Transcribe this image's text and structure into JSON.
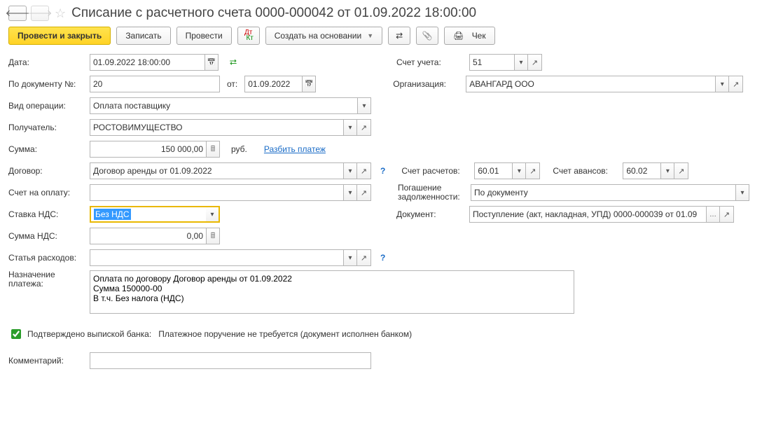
{
  "title": "Списание с расчетного счета 0000-000042 от 01.09.2022 18:00:00",
  "toolbar": {
    "post_close": "Провести и закрыть",
    "save": "Записать",
    "post": "Провести",
    "create_based": "Создать на основании",
    "cheque": "Чек"
  },
  "labels": {
    "date": "Дата:",
    "doc_no": "По документу №:",
    "from": "от:",
    "account": "Счет учета:",
    "organization": "Организация:",
    "op_type": "Вид операции:",
    "recipient": "Получатель:",
    "amount": "Сумма:",
    "rub": "руб.",
    "split": "Разбить платеж",
    "contract": "Договор:",
    "settle_acc": "Счет расчетов:",
    "advance_acc": "Счет авансов:",
    "invoice": "Счет на оплату:",
    "debt_repay1": "Погашение",
    "debt_repay2": "задолженности:",
    "vat_rate": "Ставка НДС:",
    "document": "Документ:",
    "vat_sum": "Сумма НДС:",
    "expense_item": "Статья расходов:",
    "purpose1": "Назначение",
    "purpose2": "платежа:",
    "bank_confirm": "Подтверждено выпиской банка:",
    "bank_confirm_text": "Платежное поручение не требуется (документ исполнен банком)",
    "comment": "Комментарий:"
  },
  "values": {
    "date": "01.09.2022 18:00:00",
    "doc_no": "20",
    "doc_date": "01.09.2022",
    "account": "51",
    "organization": "АВАНГАРД ООО",
    "op_type": "Оплата поставщику",
    "recipient": "РОСТОВИМУЩЕСТВО",
    "amount": "150 000,00",
    "contract": "Договор аренды от 01.09.2022",
    "settle_acc": "60.01",
    "advance_acc": "60.02",
    "debt_repay": "По документу",
    "vat_rate": "Без НДС",
    "document_ref": "Поступление (акт, накладная, УПД) 0000-000039 от 01.09",
    "vat_sum": "0,00",
    "purpose": "Оплата по договору Договор аренды от 01.09.2022\nСумма 150000-00\nВ т.ч. Без налога (НДС)"
  }
}
